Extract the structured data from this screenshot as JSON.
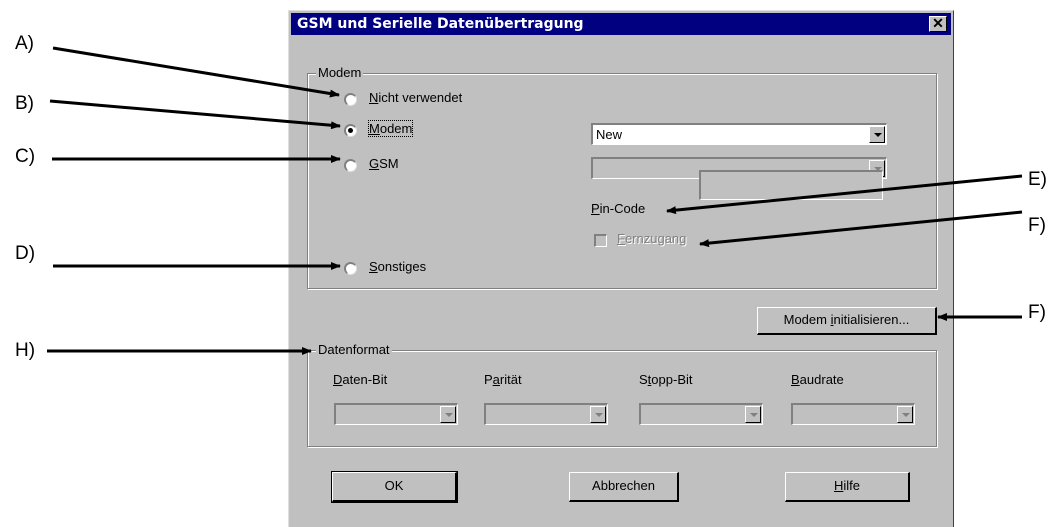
{
  "dialog": {
    "title": "GSM und Serielle Datenübertragung",
    "close": "✕"
  },
  "modem_group": {
    "legend": "Modem",
    "options": [
      {
        "accel": "N",
        "rest": "icht verwendet",
        "selected": false
      },
      {
        "accel": "M",
        "rest": "odem",
        "selected": true
      },
      {
        "accel": "G",
        "rest": "SM",
        "selected": false
      },
      {
        "accel": "S",
        "rest": "onstiges",
        "selected": false
      }
    ],
    "modem_select_value": "New",
    "gsm_select_value": "",
    "pin_label": {
      "accel": "P",
      "rest": "in-Code"
    },
    "pin_value": "",
    "fernzugang": {
      "accel": "F",
      "rest": "ernzugang",
      "checked": false,
      "enabled": false
    }
  },
  "init_button": {
    "pre": "Modem ",
    "accel": "i",
    "rest": "nitialisieren..."
  },
  "format_group": {
    "legend": "Datenformat",
    "fields": [
      {
        "pre": "",
        "accel": "D",
        "rest": "aten-Bit"
      },
      {
        "pre": "P",
        "accel": "a",
        "rest": "rität"
      },
      {
        "pre": "S",
        "accel": "t",
        "rest": "opp-Bit"
      },
      {
        "pre": "",
        "accel": "B",
        "rest": "audrate"
      }
    ]
  },
  "buttons": {
    "ok": "OK",
    "cancel": "Abbrechen",
    "help_accel": "H",
    "help_rest": "ilfe"
  },
  "callouts": {
    "a": "A)",
    "b": "B)",
    "c": "C)",
    "d": "D)",
    "e": "E)",
    "f1": "F)",
    "f2": "F)",
    "h": "H)"
  }
}
